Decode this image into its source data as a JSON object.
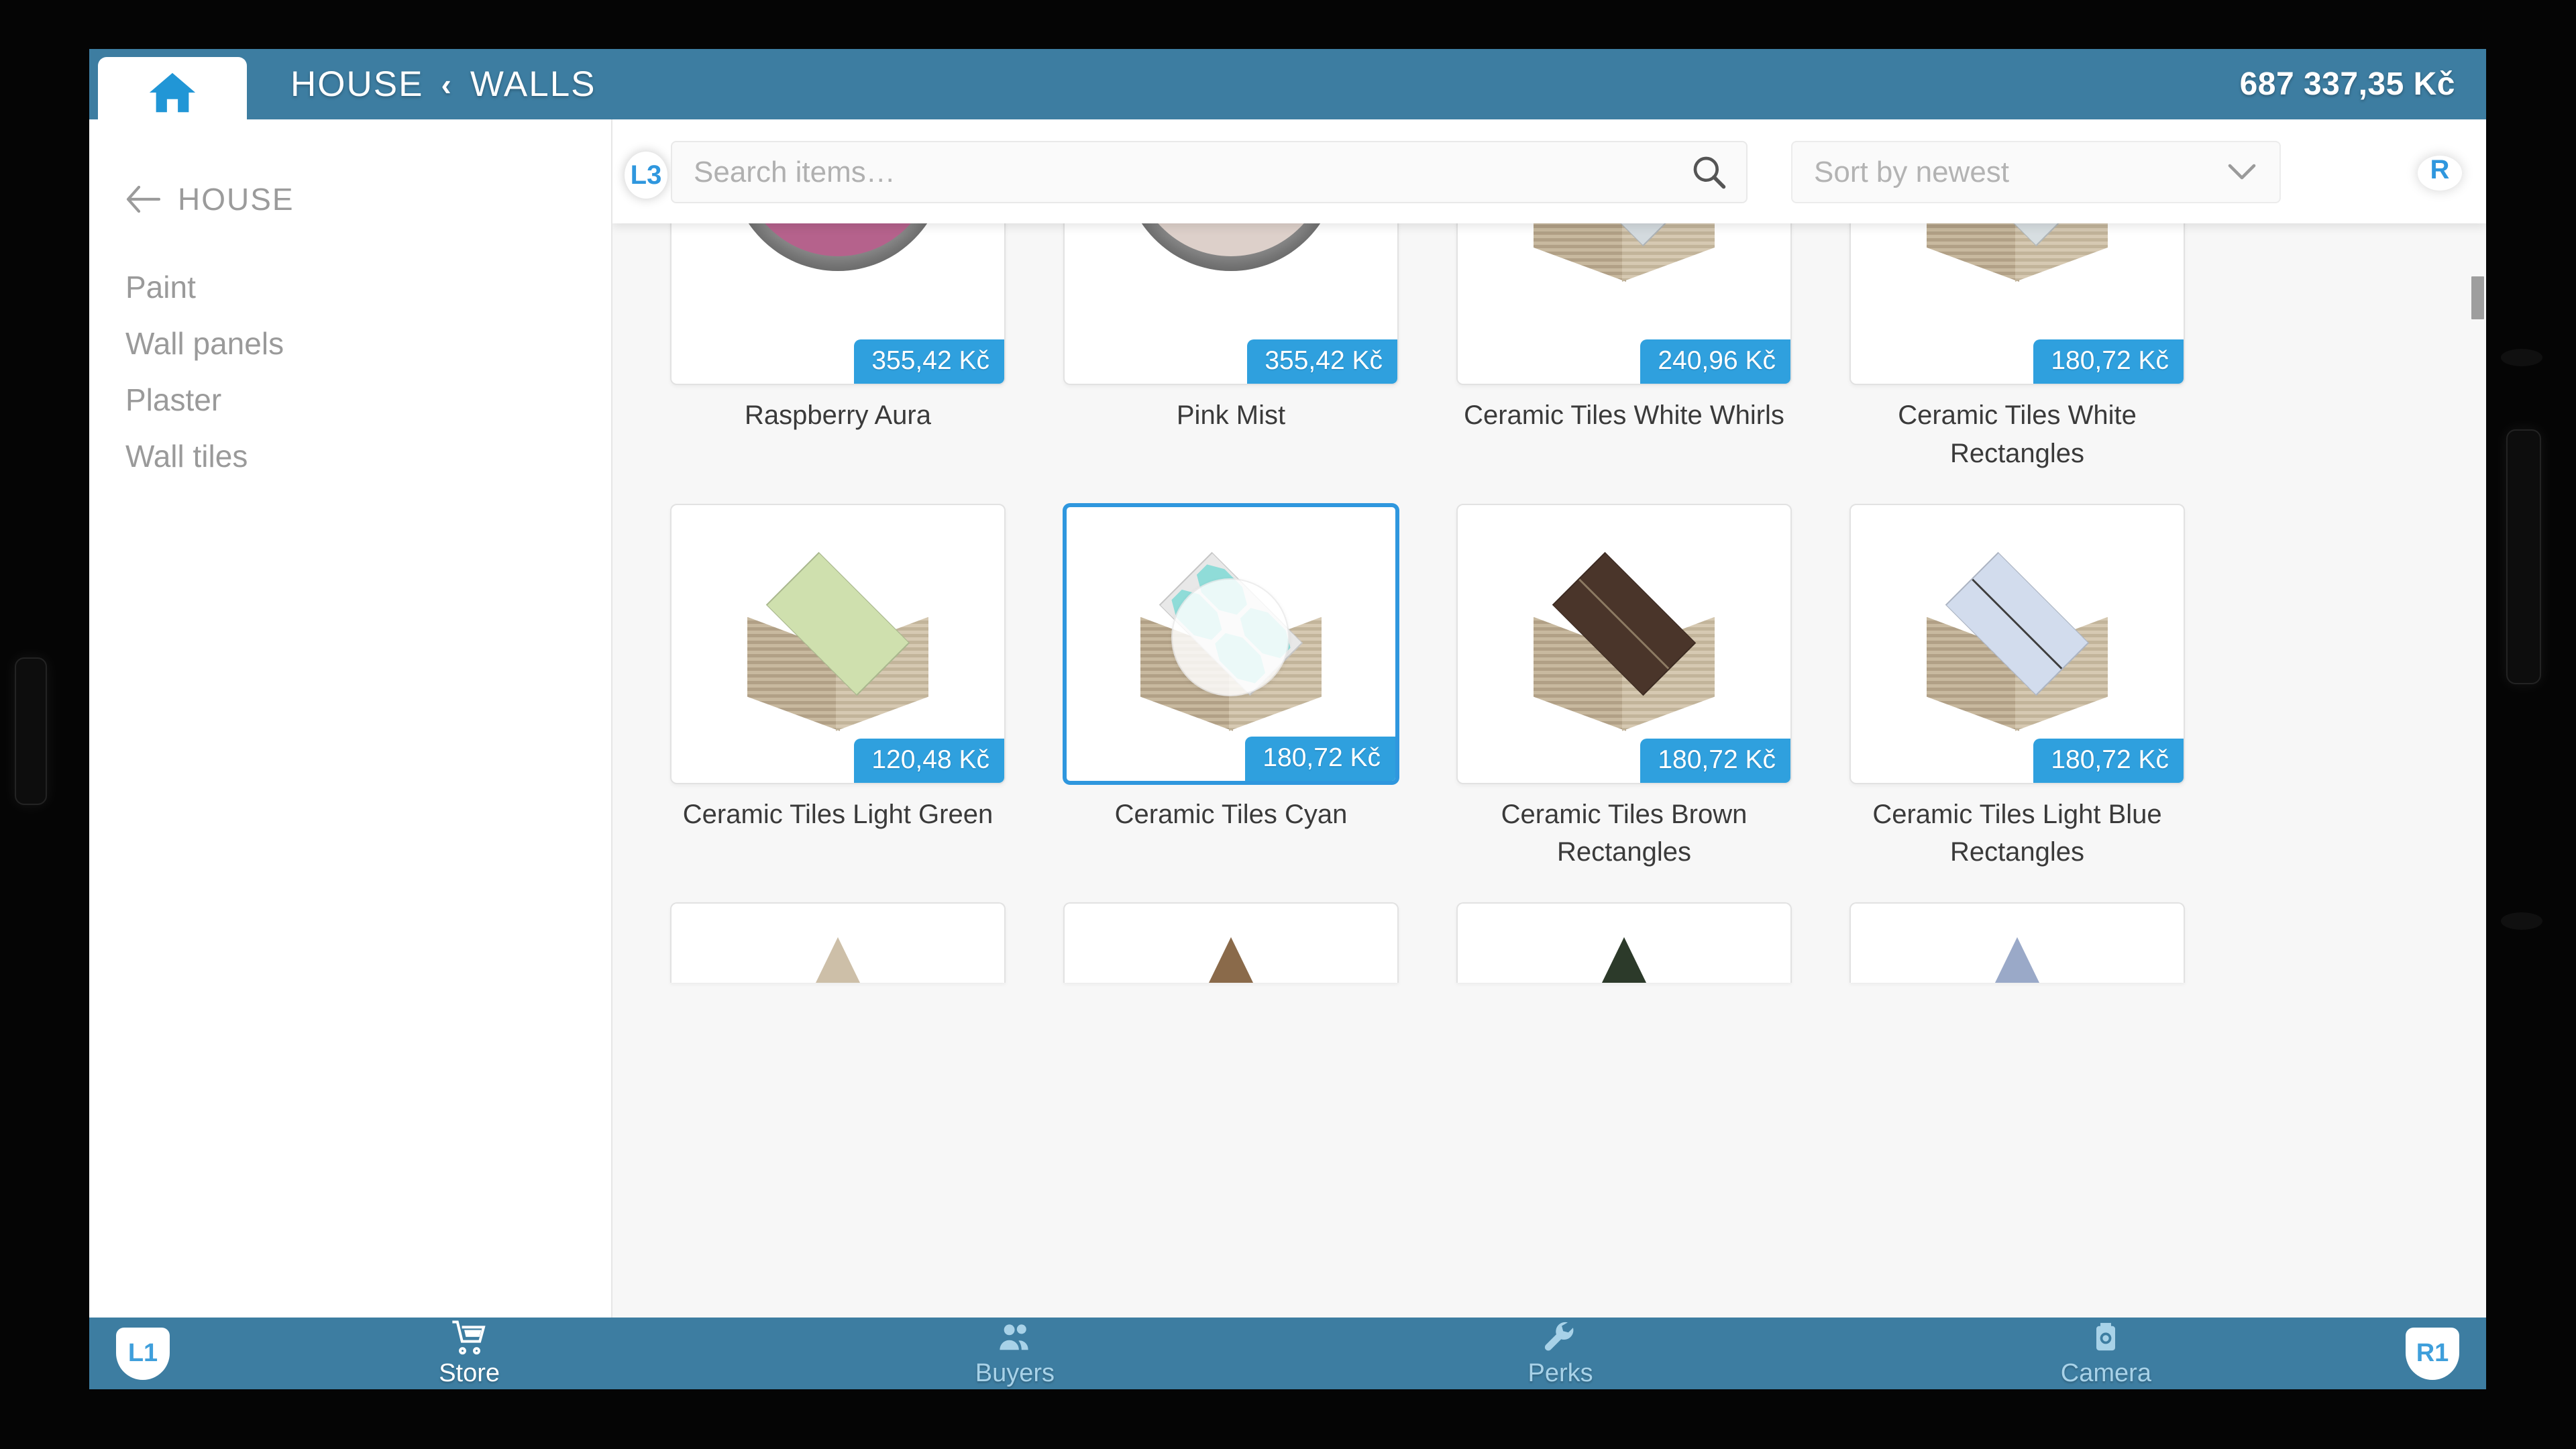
{
  "header": {
    "home_icon": "home-icon",
    "breadcrumb": [
      "HOUSE",
      "WALLS"
    ],
    "separator": "‹",
    "balance": "687 337,35 Kč"
  },
  "sidebar": {
    "back_label": "HOUSE",
    "back_icon": "arrow-left-icon",
    "items": [
      {
        "label": "Paint"
      },
      {
        "label": "Wall panels"
      },
      {
        "label": "Plaster"
      },
      {
        "label": "Wall tiles"
      }
    ]
  },
  "toolbar": {
    "l3_badge": "L3",
    "search": {
      "placeholder": "Search items…",
      "value": "",
      "icon": "search-icon"
    },
    "sort": {
      "selected": "Sort by newest",
      "icon": "chevron-down-icon"
    },
    "r_badge": "R"
  },
  "grid": {
    "items": [
      {
        "name": "Raspberry Aura",
        "price": "355,42 Kč",
        "art": "paint",
        "color": "#b5628c",
        "selected": false,
        "partial": false
      },
      {
        "name": "Pink Mist",
        "price": "355,42 Kč",
        "art": "paint",
        "color": "#ddd0ca",
        "selected": false,
        "partial": false
      },
      {
        "name": "Ceramic Tiles White Whirls",
        "price": "240,96 Kč",
        "art": "tile-grid4",
        "color": "#d3dade",
        "selected": false,
        "partial": false
      },
      {
        "name": "Ceramic Tiles White Rectangles",
        "price": "180,72 Kč",
        "art": "tile-rect",
        "color": "#d7dee1",
        "selected": false,
        "partial": false
      },
      {
        "name": "Ceramic Tiles Light Green",
        "price": "120,48 Kč",
        "art": "tile-plain",
        "color": "#cfe0ae",
        "selected": false,
        "partial": false
      },
      {
        "name": "Ceramic Tiles Cyan",
        "price": "180,72 Kč",
        "art": "tile-octagon",
        "color": "#8fdcd8",
        "selected": true,
        "partial": false
      },
      {
        "name": "Ceramic Tiles Brown Rectangles",
        "price": "180,72 Kč",
        "art": "tile-rect",
        "color": "#4a352a",
        "selected": false,
        "partial": false
      },
      {
        "name": "Ceramic Tiles Light Blue Rectangles",
        "price": "180,72 Kč",
        "art": "tile-rect",
        "color": "#d2dced",
        "selected": false,
        "partial": false
      },
      {
        "name": "",
        "price": "",
        "art": "partial",
        "color": "#cdbfa8",
        "selected": false,
        "partial": true
      },
      {
        "name": "",
        "price": "",
        "art": "partial",
        "color": "#8a6a4a",
        "selected": false,
        "partial": true
      },
      {
        "name": "",
        "price": "",
        "art": "partial",
        "color": "#2c3a2a",
        "selected": false,
        "partial": true
      },
      {
        "name": "",
        "price": "",
        "art": "partial",
        "color": "#2a3a6a",
        "selected": false,
        "partial": true
      }
    ]
  },
  "bottombar": {
    "l1_badge": "L1",
    "r1_badge": "R1",
    "nav": [
      {
        "label": "Store",
        "icon": "shopping-cart-icon",
        "active": true
      },
      {
        "label": "Buyers",
        "icon": "people-icon",
        "active": false
      },
      {
        "label": "Perks",
        "icon": "wrench-icon",
        "active": false
      },
      {
        "label": "Camera",
        "icon": "camera-icon",
        "active": false
      }
    ]
  },
  "colors": {
    "header_blue": "#3d7da1",
    "accent_blue": "#2f97de",
    "price_blue": "#2fa0de",
    "panel_bg": "#f7f7f7"
  }
}
